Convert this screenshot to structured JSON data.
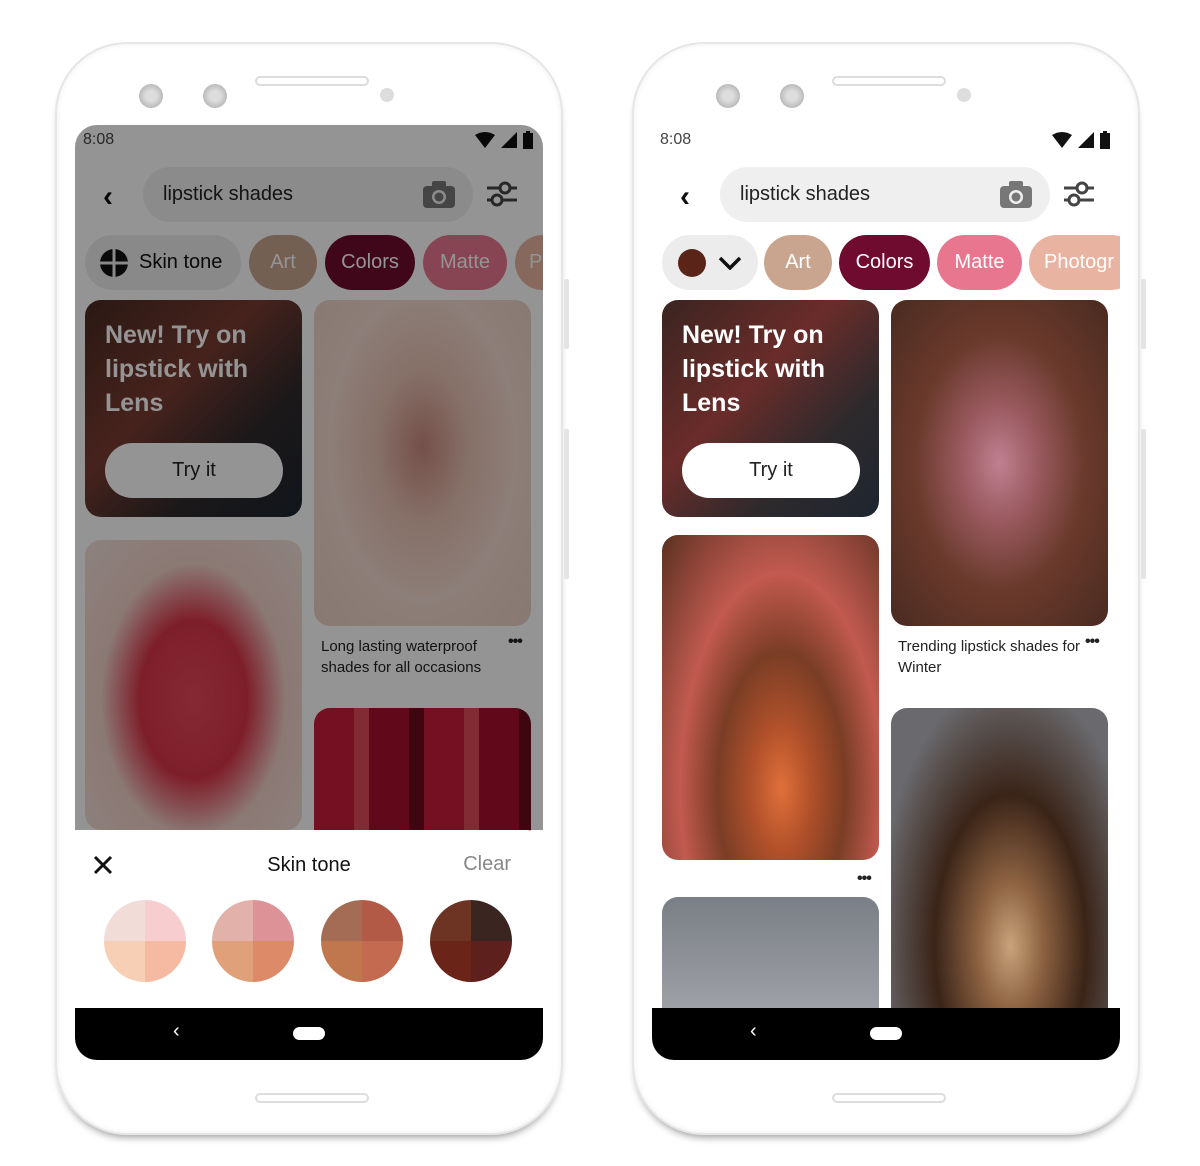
{
  "left_phone": {
    "status_time": "8:08",
    "search_value": "lipstick shades",
    "chips": [
      {
        "label": "Skin tone",
        "color": "#ececec"
      },
      {
        "label": "Art",
        "color": "#c9a58f"
      },
      {
        "label": "Colors",
        "color": "#6e0b2e"
      },
      {
        "label": "Matte",
        "color": "#e9768f"
      },
      {
        "label": "P",
        "color": "#e8b3a1"
      }
    ],
    "lens_card": {
      "title": "New! Try on lipstick with Lens",
      "button": "Try it"
    },
    "pin_caption": "Long lasting waterproof shades for all occasions",
    "sheet": {
      "title": "Skin tone",
      "clear": "Clear",
      "tones": [
        [
          "#f1dcd8",
          "#f7cdd0",
          "#f7cfb5",
          "#f6b9a1"
        ],
        [
          "#e2b2aa",
          "#dc9297",
          "#e0a17a",
          "#dc8a68"
        ],
        [
          "#a46c55",
          "#b25a45",
          "#c0774d",
          "#c46a50"
        ],
        [
          "#6d3423",
          "#3b2520",
          "#6b2418",
          "#5e201c"
        ]
      ]
    }
  },
  "right_phone": {
    "status_time": "8:08",
    "search_value": "lipstick shades",
    "selected_tone_color": "#5a2418",
    "chips": [
      {
        "label": "Art",
        "color": "#c9a58f"
      },
      {
        "label": "Colors",
        "color": "#6e0b2e"
      },
      {
        "label": "Matte",
        "color": "#e9768f"
      },
      {
        "label": "Photogr",
        "color": "#e8b3a1"
      }
    ],
    "lens_card": {
      "title": "New! Try on lipstick with Lens",
      "button": "Try it"
    },
    "pin_caption": "Trending lipstick shades for Winter"
  }
}
